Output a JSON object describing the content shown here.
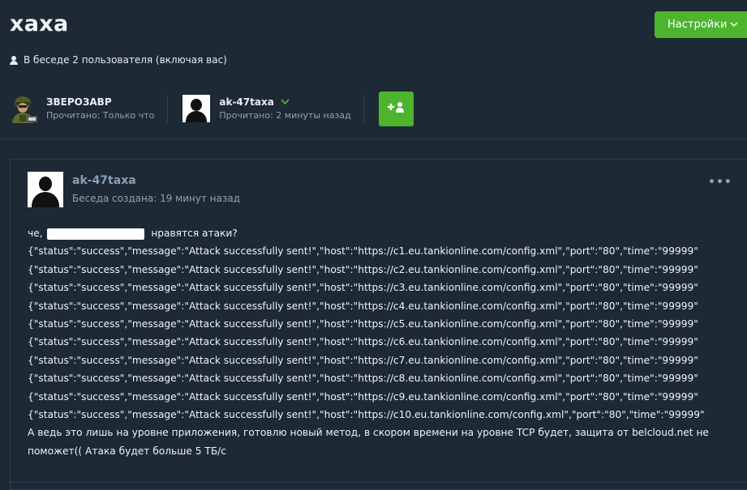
{
  "conversation": {
    "title": "хаха",
    "members_text": "В беседе 2 пользователя (включая вас)"
  },
  "toolbar": {
    "settings_label": "Настройки",
    "settings_icon": "chevron-down-icon"
  },
  "participants": [
    {
      "name": "ЗВЕРОЗАВР",
      "read": "Прочитано: Только что",
      "avatar": "soldier-avatar"
    },
    {
      "name": "ak-47taxa",
      "read": "Прочитано: 2 минуты назад",
      "avatar": "default-avatar",
      "badge_icon": "check-icon"
    }
  ],
  "invite": {
    "icon": "add-user-icon",
    "label": "+"
  },
  "message": {
    "author": "ak-47taxa",
    "created": "Беседа создана: 19 минут назад",
    "menu_icon": "more-icon",
    "greeting_prefix": "че,",
    "greeting_suffix": "нравятся атаки?",
    "json_lines": [
      "{\"status\":\"success\",\"message\":\"Attack successfully sent!\",\"host\":\"https://c1.eu.tankionline.com/config.xml\",\"port\":\"80\",\"time\":\"99999\"",
      "{\"status\":\"success\",\"message\":\"Attack successfully sent!\",\"host\":\"https://c2.eu.tankionline.com/config.xml\",\"port\":\"80\",\"time\":\"99999\"",
      "{\"status\":\"success\",\"message\":\"Attack successfully sent!\",\"host\":\"https://c3.eu.tankionline.com/config.xml\",\"port\":\"80\",\"time\":\"99999\"",
      "{\"status\":\"success\",\"message\":\"Attack successfully sent!\",\"host\":\"https://c4.eu.tankionline.com/config.xml\",\"port\":\"80\",\"time\":\"99999\"",
      "{\"status\":\"success\",\"message\":\"Attack successfully sent!\",\"host\":\"https://c5.eu.tankionline.com/config.xml\",\"port\":\"80\",\"time\":\"99999\"",
      "{\"status\":\"success\",\"message\":\"Attack successfully sent!\",\"host\":\"https://c6.eu.tankionline.com/config.xml\",\"port\":\"80\",\"time\":\"99999\"",
      "{\"status\":\"success\",\"message\":\"Attack successfully sent!\",\"host\":\"https://c7.eu.tankionline.com/config.xml\",\"port\":\"80\",\"time\":\"99999\"",
      "{\"status\":\"success\",\"message\":\"Attack successfully sent!\",\"host\":\"https://c8.eu.tankionline.com/config.xml\",\"port\":\"80\",\"time\":\"99999\"",
      "{\"status\":\"success\",\"message\":\"Attack successfully sent!\",\"host\":\"https://c9.eu.tankionline.com/config.xml\",\"port\":\"80\",\"time\":\"99999\"",
      "{\"status\":\"success\",\"message\":\"Attack successfully sent!\",\"host\":\"https://c10.eu.tankionline.com/config.xml\",\"port\":\"80\",\"time\":\"99999\""
    ],
    "closing_text": "А ведь это лишь на уровне приложения, готовлю новый метод, в скором времени на уровне TCP будет, защита от belcloud.net не поможет(( Атака будет больше 5 ТБ/с"
  },
  "colors": {
    "background": "#1d2935",
    "accent_green": "#4cb52d",
    "muted_text": "#8fa2b3",
    "divider": "#2f3f4f"
  }
}
